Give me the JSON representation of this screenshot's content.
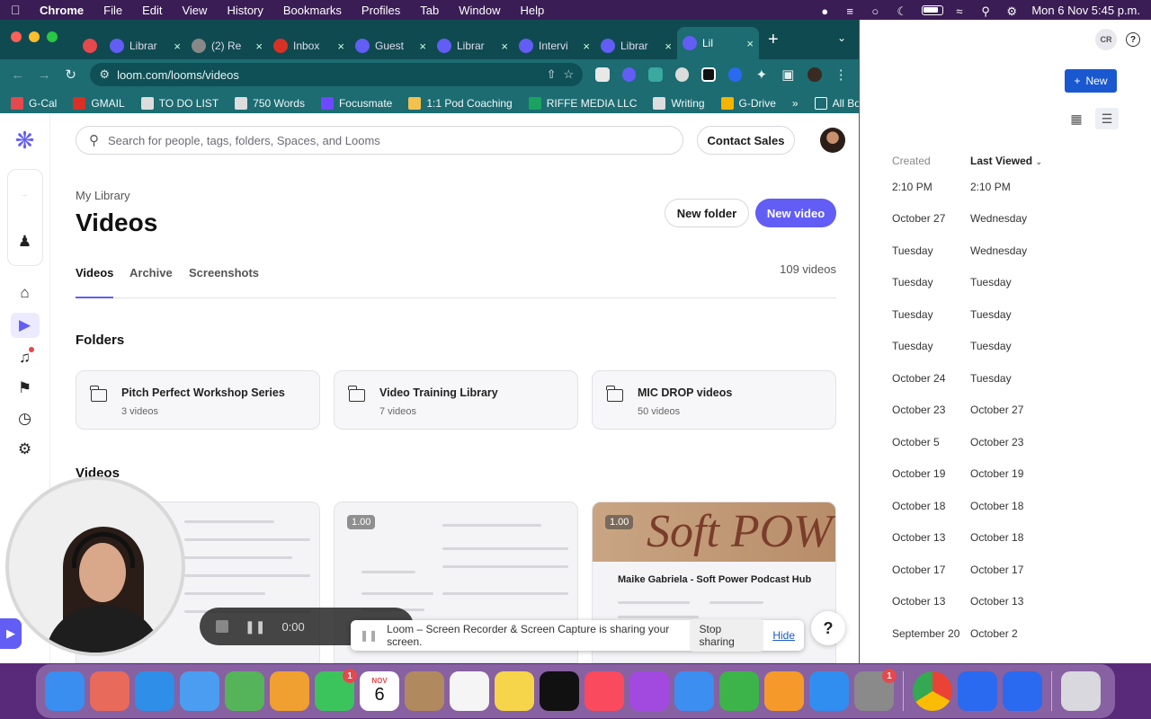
{
  "menubar": {
    "app": "Chrome",
    "items": [
      "File",
      "Edit",
      "View",
      "History",
      "Bookmarks",
      "Profiles",
      "Tab",
      "Window",
      "Help"
    ],
    "datetime": "Mon 6 Nov  5:45 p.m."
  },
  "browser": {
    "tabs": [
      {
        "label": "",
        "icon_color": "#e5484d",
        "active": false
      },
      {
        "label": "Librar",
        "icon_color": "#625df5",
        "active": false
      },
      {
        "label": "(2) Re",
        "icon_color": "#888888",
        "active": false
      },
      {
        "label": "Inbox",
        "icon_color": "#d93025",
        "active": false
      },
      {
        "label": "Guest",
        "icon_color": "#625df5",
        "active": false
      },
      {
        "label": "Librar",
        "icon_color": "#625df5",
        "active": false
      },
      {
        "label": "Intervi",
        "icon_color": "#625df5",
        "active": false
      },
      {
        "label": "Librar",
        "icon_color": "#625df5",
        "active": false
      },
      {
        "label": "Lil",
        "icon_color": "#625df5",
        "active": true
      }
    ],
    "url": "loom.com/looms/videos",
    "bookmarks": [
      {
        "label": "G-Cal",
        "color": "#e5484d"
      },
      {
        "label": "GMAIL",
        "color": "#d93025"
      },
      {
        "label": "TO DO LIST",
        "color": "#dddddd"
      },
      {
        "label": "750 Words",
        "color": "#dddddd"
      },
      {
        "label": "Focusmate",
        "color": "#6d4aff"
      },
      {
        "label": "1:1 Pod Coaching",
        "color": "#f2c14e"
      },
      {
        "label": "RIFFE MEDIA LLC",
        "color": "#1aa260"
      },
      {
        "label": "Writing",
        "color": "#dddddd"
      },
      {
        "label": "G-Drive",
        "color": "#f4b400"
      }
    ],
    "all_bookmarks": "All Bookmarks"
  },
  "loom": {
    "search_placeholder": "Search for people, tags, folders, Spaces, and Looms",
    "contact_sales": "Contact Sales",
    "breadcrumb": "My Library",
    "title": "Videos",
    "new_folder": "New folder",
    "new_video": "New video",
    "tabs": [
      "Videos",
      "Archive",
      "Screenshots"
    ],
    "video_count": "109 videos",
    "folders_heading": "Folders",
    "folders": [
      {
        "name": "Pitch Perfect Workshop Series",
        "count": "3 videos"
      },
      {
        "name": "Video Training Library",
        "count": "7 videos"
      },
      {
        "name": "MIC DROP videos",
        "count": "50 videos"
      }
    ],
    "videos_heading": "Videos",
    "video_cards": [
      {
        "speed": "",
        "title": ""
      },
      {
        "speed": "1.00",
        "title": ""
      },
      {
        "speed": "1.00",
        "title": "Maike Gabriela - Soft Power Podcast Hub",
        "banner": "Soft POW"
      }
    ],
    "accent": "#625df5"
  },
  "recorder": {
    "time": "0:00",
    "share_text": "Loom – Screen Recorder & Screen Capture is sharing your screen.",
    "stop_sharing": "Stop sharing",
    "hide": "Hide",
    "help": "?"
  },
  "bgapp": {
    "new_label": "New",
    "avatar": "CR",
    "columns": [
      "Created",
      "Last Viewed"
    ],
    "rows": [
      [
        "2:10 PM",
        "2:10 PM"
      ],
      [
        "October 27",
        "Wednesday"
      ],
      [
        "Tuesday",
        "Wednesday"
      ],
      [
        "Tuesday",
        "Tuesday"
      ],
      [
        "Tuesday",
        "Tuesday"
      ],
      [
        "Tuesday",
        "Tuesday"
      ],
      [
        "October 24",
        "Tuesday"
      ],
      [
        "October 23",
        "October 27"
      ],
      [
        "October 5",
        "October 23"
      ],
      [
        "October 19",
        "October 19"
      ],
      [
        "October 18",
        "October 18"
      ],
      [
        "October 13",
        "October 18"
      ],
      [
        "October 17",
        "October 17"
      ],
      [
        "October 13",
        "October 13"
      ],
      [
        "September 20",
        "October 2"
      ]
    ]
  },
  "dock": {
    "calendar_month": "NOV",
    "calendar_day": "6",
    "apps": [
      {
        "name": "finder",
        "color": "#3a8ef0"
      },
      {
        "name": "launchpad",
        "color": "#e86a5a"
      },
      {
        "name": "safari",
        "color": "#2f8ee8"
      },
      {
        "name": "mail",
        "color": "#4a9df0"
      },
      {
        "name": "maps",
        "color": "#55b45a"
      },
      {
        "name": "photos",
        "color": "#f0a030"
      },
      {
        "name": "facetime",
        "color": "#3cc45c",
        "badge": "1"
      },
      {
        "name": "calendar",
        "color": "#ffffff"
      },
      {
        "name": "contacts",
        "color": "#b08a5e"
      },
      {
        "name": "reminders",
        "color": "#f5f5f5"
      },
      {
        "name": "notes",
        "color": "#f6d54a"
      },
      {
        "name": "tv",
        "color": "#111111"
      },
      {
        "name": "music",
        "color": "#fa4a5e"
      },
      {
        "name": "podcasts",
        "color": "#a24ae0"
      },
      {
        "name": "keynote",
        "color": "#3c8ef0"
      },
      {
        "name": "numbers",
        "color": "#3cb44a"
      },
      {
        "name": "pages",
        "color": "#f59a2a"
      },
      {
        "name": "app-store",
        "color": "#2f8ef0"
      },
      {
        "name": "system-settings",
        "color": "#8a8a8a",
        "badge": "1"
      },
      {
        "name": "chrome",
        "color": "#ffffff"
      },
      {
        "name": "docs-a",
        "color": "#2a6af0"
      },
      {
        "name": "docs-b",
        "color": "#2a6af0"
      },
      {
        "name": "trash",
        "color": "#d8d8de"
      }
    ]
  }
}
